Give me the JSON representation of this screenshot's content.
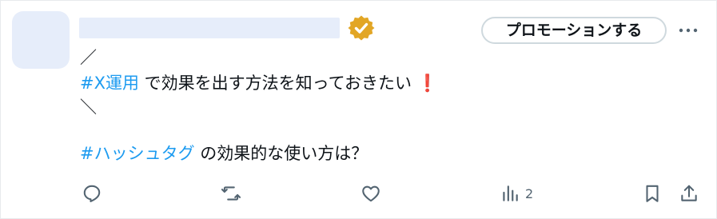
{
  "header": {
    "promo_label": "プロモーションする",
    "verified_badge_color": "#e2a625",
    "placeholder_color": "#e6edfa"
  },
  "post": {
    "line1_mark": "／",
    "hashtag1": "#X運用",
    "line2_text": " で効果を出す方法を知っておきたい ",
    "exclaim": "❗",
    "line3_mark": "＼",
    "hashtag2": "#ハッシュタグ",
    "line5_text": " の効果的な使い方は？",
    "hashtag_color": "#1d9bf0"
  },
  "actions": {
    "reply_icon": "reply-icon",
    "repost_icon": "repost-icon",
    "like_icon": "like-icon",
    "views_icon": "views-icon",
    "views_count": "2",
    "bookmark_icon": "bookmark-icon",
    "share_icon": "share-icon",
    "icon_color": "#536471"
  }
}
